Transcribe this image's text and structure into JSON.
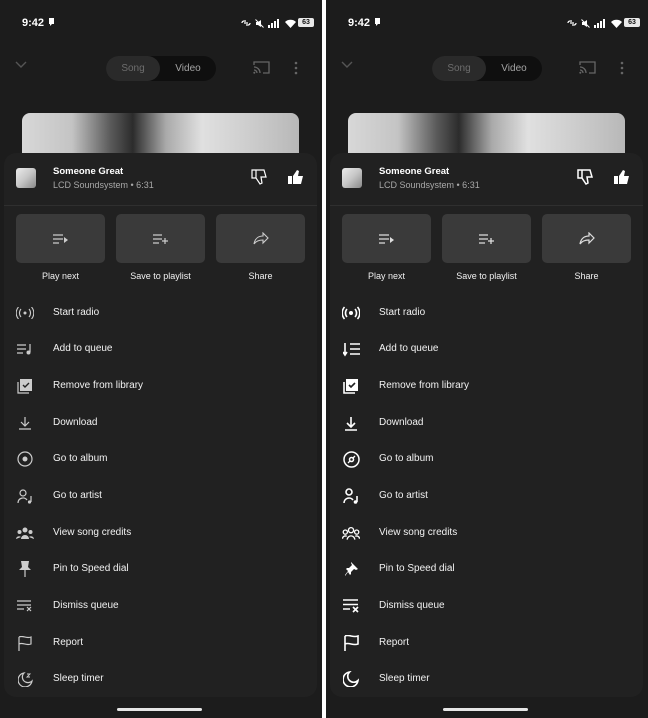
{
  "status": {
    "time": "9:42",
    "battery": "63"
  },
  "player": {
    "toggle_song": "Song",
    "toggle_video": "Video"
  },
  "song": {
    "title": "Someone Great",
    "subtitle": "LCD Soundsystem • 6:31"
  },
  "actions": [
    {
      "label": "Play next",
      "icon": "play-next-icon"
    },
    {
      "label": "Save to playlist",
      "icon": "playlist-add-icon"
    },
    {
      "label": "Share",
      "icon": "share-icon"
    }
  ],
  "menu": [
    {
      "label": "Start radio",
      "icon": "radio-icon"
    },
    {
      "label": "Add to queue",
      "icon": "queue-add-icon"
    },
    {
      "label": "Remove from library",
      "icon": "library-remove-icon"
    },
    {
      "label": "Download",
      "icon": "download-icon"
    },
    {
      "label": "Go to album",
      "icon": "album-icon"
    },
    {
      "label": "Go to artist",
      "icon": "artist-icon"
    },
    {
      "label": "View song credits",
      "icon": "credits-icon"
    },
    {
      "label": "Pin to Speed dial",
      "icon": "pin-icon"
    },
    {
      "label": "Dismiss queue",
      "icon": "dismiss-queue-icon"
    },
    {
      "label": "Report",
      "icon": "flag-icon"
    },
    {
      "label": "Sleep timer",
      "icon": "sleep-timer-icon"
    }
  ],
  "colors": {
    "background": "#1c1c1c",
    "sheet": "#212121",
    "action_box": "#3a3a3a",
    "text": "#ffffff",
    "muted_text": "#a8a8a8"
  }
}
